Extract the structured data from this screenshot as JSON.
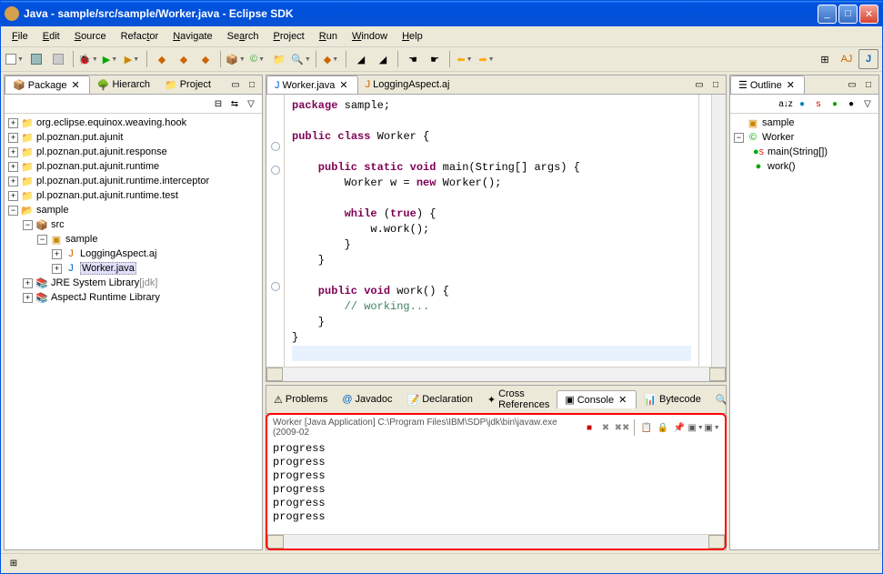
{
  "window": {
    "title": "Java - sample/src/sample/Worker.java - Eclipse SDK"
  },
  "menu": [
    "File",
    "Edit",
    "Source",
    "Refactor",
    "Navigate",
    "Search",
    "Project",
    "Run",
    "Window",
    "Help"
  ],
  "package_explorer": {
    "tab1": "Package",
    "tab2": "Hierarch",
    "tab3": "Project",
    "items": [
      "org.eclipse.equinox.weaving.hook",
      "pl.poznan.put.ajunit",
      "pl.poznan.put.ajunit.response",
      "pl.poznan.put.ajunit.runtime",
      "pl.poznan.put.ajunit.runtime.interceptor",
      "pl.poznan.put.ajunit.runtime.test"
    ],
    "open_project": "sample",
    "src": "src",
    "pkg": "sample",
    "file1": "LoggingAspect.aj",
    "file2": "Worker.java",
    "jre": "JRE System Library",
    "jre_tag": "[jdk]",
    "aspectj": "AspectJ Runtime Library"
  },
  "editor": {
    "tab1": "Worker.java",
    "tab2": "LoggingAspect.aj"
  },
  "outline": {
    "title": "Outline",
    "pkg": "sample",
    "cls": "Worker",
    "m1": "main(String[])",
    "m2": "work()"
  },
  "bottom": {
    "tabs": [
      "Problems",
      "Javadoc",
      "Declaration",
      "Cross References",
      "Console",
      "Bytecode",
      "Search"
    ],
    "console_desc": "Worker [Java Application] C:\\Program Files\\IBM\\SDP\\jdk\\bin\\javaw.exe (2009-02",
    "lines": [
      "progress",
      "progress",
      "progress",
      "progress",
      "progress",
      "progress"
    ]
  },
  "code": {
    "l1": "package",
    "l1b": " sample;",
    "l3a": "public",
    "l3b": " class",
    "l3c": " Worker {",
    "l5a": "    public",
    "l5b": " static",
    "l5c": " void",
    "l5d": " main(String[] args) {",
    "l6a": "        Worker w = ",
    "l6b": "new",
    "l6c": " Worker();",
    "l8a": "        while",
    "l8b": " (",
    "l8c": "true",
    "l8d": ") {",
    "l9": "            w.work();",
    "l10": "        }",
    "l11": "    }",
    "l13a": "    public",
    "l13b": " void",
    "l13c": " work() {",
    "l14a": "        // working...",
    "l15": "    }",
    "l16": "}"
  }
}
